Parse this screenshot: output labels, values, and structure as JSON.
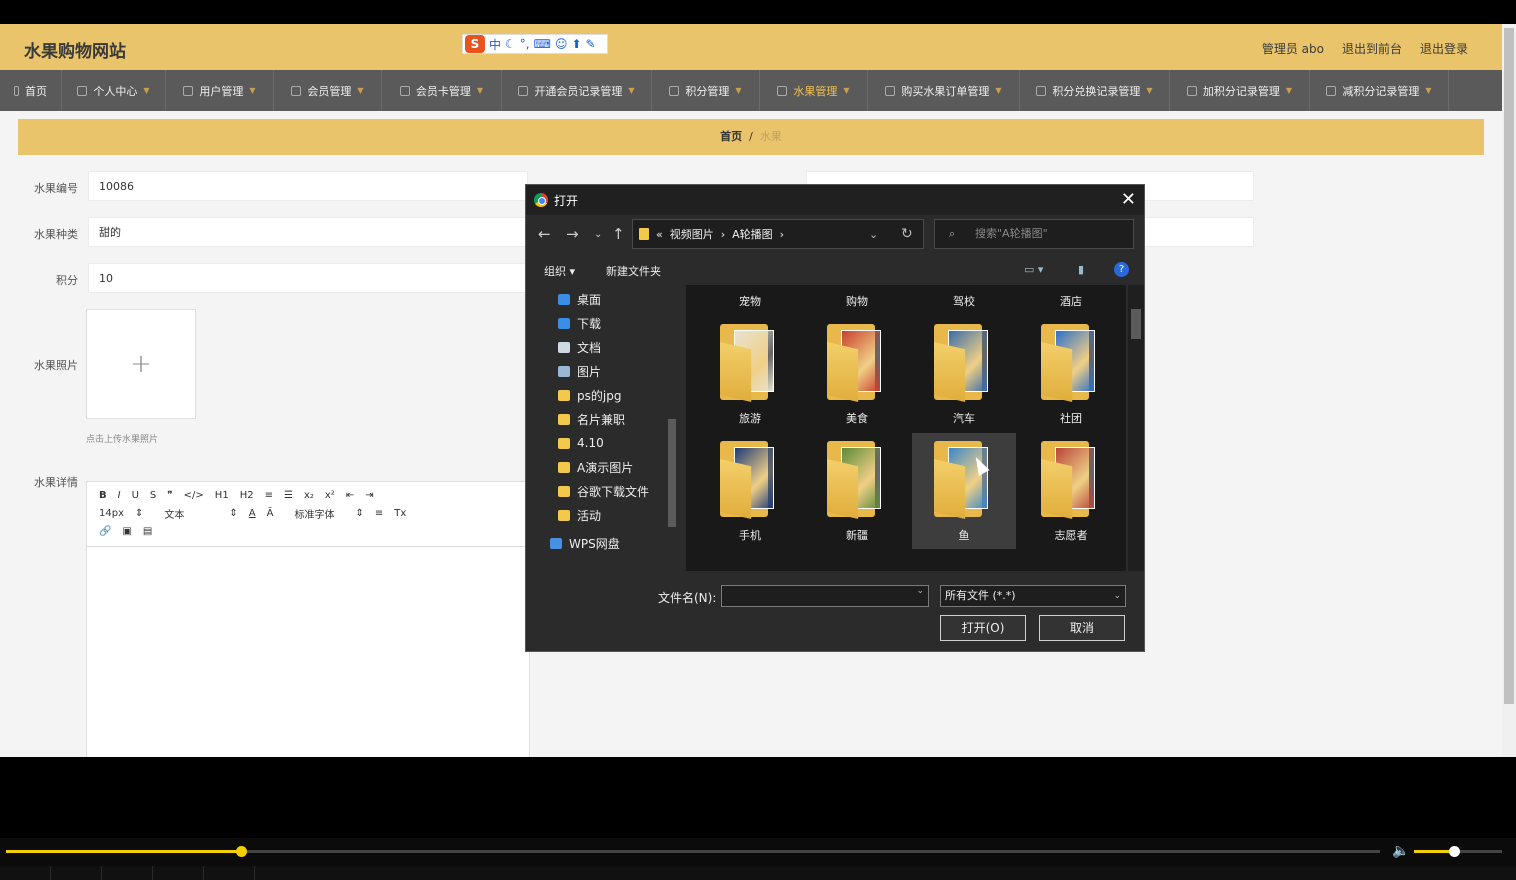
{
  "site": {
    "title": "水果购物网站",
    "ime_label": "中"
  },
  "header_links": [
    "管理员 abo",
    "退出到前台",
    "退出登录"
  ],
  "nav": [
    {
      "label": "首页",
      "caret": false
    },
    {
      "label": "个人中心",
      "caret": true
    },
    {
      "label": "用户管理",
      "caret": true
    },
    {
      "label": "会员管理",
      "caret": true
    },
    {
      "label": "会员卡管理",
      "caret": true
    },
    {
      "label": "开通会员记录管理",
      "caret": true
    },
    {
      "label": "积分管理",
      "caret": true
    },
    {
      "label": "水果管理",
      "caret": true,
      "active": true
    },
    {
      "label": "购买水果订单管理",
      "caret": true
    },
    {
      "label": "积分兑换记录管理",
      "caret": true
    },
    {
      "label": "加积分记录管理",
      "caret": true
    },
    {
      "label": "减积分记录管理",
      "caret": true
    }
  ],
  "breadcrumb": {
    "home": "首页",
    "sep": "/",
    "current": "水果"
  },
  "form": {
    "code_label": "水果编号",
    "code_value": "10086",
    "type_label": "水果种类",
    "type_value": "甜的",
    "points_label": "积分",
    "points_value": "10",
    "photo_label": "水果照片",
    "photo_plus": "+",
    "photo_hint": "点击上传水果照片",
    "detail_label": "水果详情"
  },
  "editor": {
    "row1": [
      "B",
      "I",
      "U",
      "S",
      "❞",
      "</>",
      "H1",
      "H2",
      "≡",
      "☰",
      "x₂",
      "x²",
      "⇤",
      "⇥"
    ],
    "size": "14px",
    "block": "文本",
    "font": "标准字体"
  },
  "dialog": {
    "title": "打开",
    "close": "✕",
    "path": [
      "«",
      "视频图片",
      "›",
      "A轮播图",
      "›"
    ],
    "search_placeholder": "搜索\"A轮播图\"",
    "organize": "组织 ▾",
    "new_folder": "新建文件夹",
    "nav_items": [
      {
        "label": "桌面",
        "pin": true,
        "color": "#3a8ee6"
      },
      {
        "label": "下载",
        "pin": true,
        "color": "#3a8ee6"
      },
      {
        "label": "文档",
        "pin": true,
        "color": "#cfd8e3"
      },
      {
        "label": "图片",
        "pin": true,
        "color": "#9ab7d6"
      },
      {
        "label": "ps的jpg",
        "pin": true,
        "color": "#f2c94c"
      },
      {
        "label": "名片兼职",
        "pin": true,
        "color": "#f2c94c"
      },
      {
        "label": "4.10",
        "pin": false,
        "color": "#f2c94c"
      },
      {
        "label": "A演示图片",
        "pin": false,
        "color": "#f2c94c"
      },
      {
        "label": "谷歌下载文件",
        "pin": false,
        "color": "#f2c94c"
      },
      {
        "label": "活动",
        "pin": false,
        "color": "#f2c94c"
      },
      {
        "label": "WPS网盘",
        "pin": false,
        "color": "#4a90e2"
      }
    ],
    "files": [
      {
        "name": "宠物",
        "pic": "#c97a3a"
      },
      {
        "name": "购物",
        "pic": "#d8463a"
      },
      {
        "name": "驾校",
        "pic": "#5b86b8"
      },
      {
        "name": "酒店",
        "pic": "#6b7c3a"
      },
      {
        "name": "旅游",
        "pic": "#e9e2d0"
      },
      {
        "name": "美食",
        "pic": "#c9402e"
      },
      {
        "name": "汽车",
        "pic": "#3a6ea8"
      },
      {
        "name": "社团",
        "pic": "#2f6fc9"
      },
      {
        "name": "手机",
        "pic": "#1e3a78"
      },
      {
        "name": "新疆",
        "pic": "#5e8a3a"
      },
      {
        "name": "鱼",
        "pic": "#3a88c8",
        "selected": true
      },
      {
        "name": "志愿者",
        "pic": "#b8463a"
      }
    ],
    "filename_label": "文件名(N):",
    "filename_value": "",
    "filetype": "所有文件 (*.*)",
    "open_button": "打开(O)",
    "cancel_button": "取消"
  },
  "player": {
    "progress": 0.171,
    "volume": 0.45
  }
}
